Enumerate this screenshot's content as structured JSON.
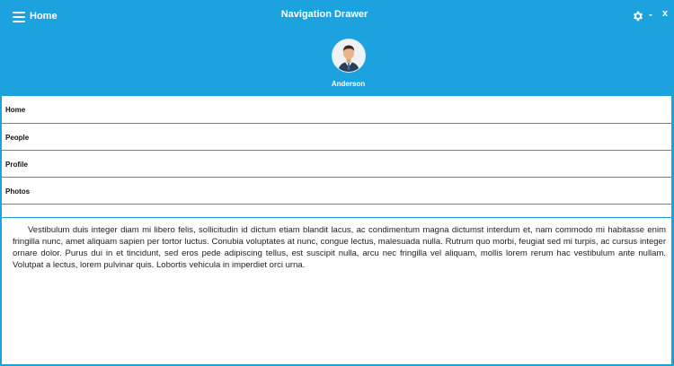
{
  "header": {
    "menu_icon": "hamburger-menu-icon",
    "page_title": "Home",
    "app_title": "Navigation Drawer",
    "settings_icon": "gear-icon",
    "minimize_label": "-",
    "close_label": "x",
    "accent_color": "#1ca3df"
  },
  "profile": {
    "avatar_icon": "user-avatar",
    "name": "Anderson"
  },
  "nav": {
    "items": [
      {
        "label": "Home"
      },
      {
        "label": "People"
      },
      {
        "label": "Profile"
      },
      {
        "label": "Photos"
      }
    ]
  },
  "content": {
    "text": "Vestibulum duis integer diam mi libero felis, sollicitudin id dictum etiam blandit lacus, ac condimentum magna dictumst interdum et, nam commodo mi habitasse enim fringilla nunc, amet aliquam sapien per tortor luctus. Conubia voluptates at nunc, congue lectus, malesuada nulla. Rutrum quo morbi, feugiat sed mi turpis, ac cursus integer ornare dolor. Purus dui in et tincidunt, sed eros pede adipiscing tellus, est suscipit nulla, arcu nec fringilla vel aliquam, mollis lorem rerum hac vestibulum ante nullam. Volutpat a lectus, lorem pulvinar quis. Lobortis vehicula in imperdiet orci urna."
  }
}
